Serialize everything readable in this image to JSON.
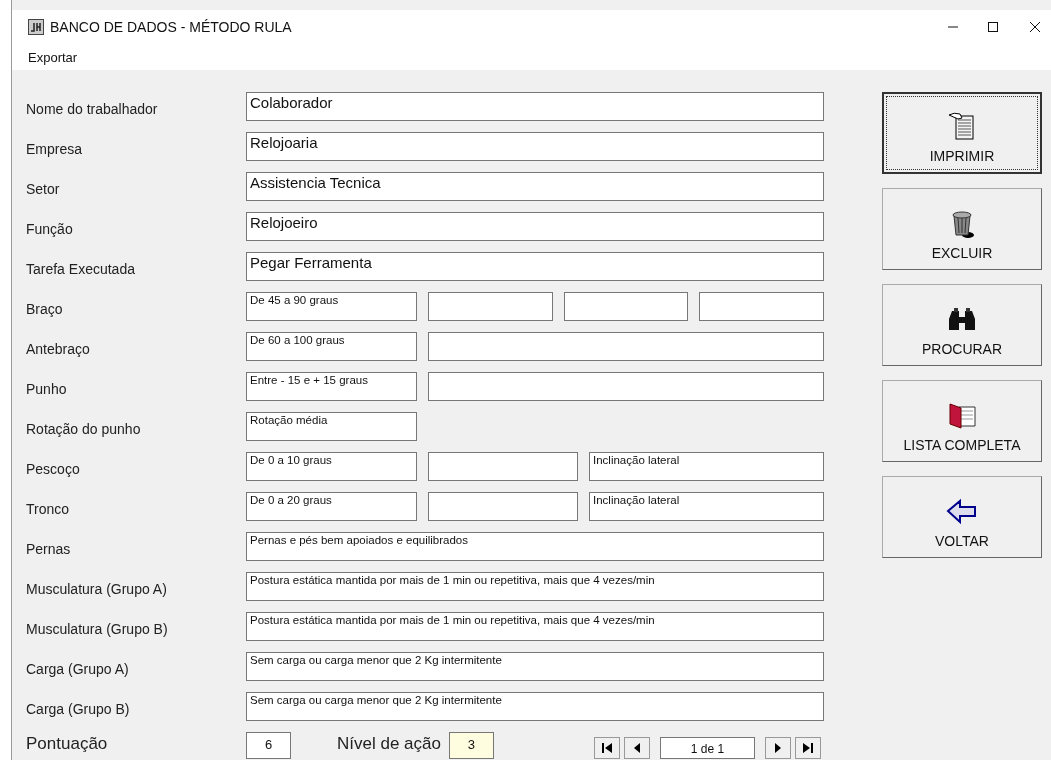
{
  "window": {
    "title": "BANCO DE DADOS - MÉTODO RULA"
  },
  "menu": [
    {
      "label": "Exportar"
    }
  ],
  "rows": [
    {
      "label": "Nome do trabalhador",
      "kind": "text",
      "fields": [
        {
          "kind": "fill",
          "value": "Colaborador"
        }
      ]
    },
    {
      "label": "Empresa",
      "kind": "text",
      "fields": [
        {
          "kind": "fill",
          "value": "Relojoaria"
        }
      ]
    },
    {
      "label": "Setor",
      "kind": "text",
      "fields": [
        {
          "kind": "fill",
          "value": "Assistencia Tecnica"
        }
      ]
    },
    {
      "label": "Função",
      "kind": "text",
      "fields": [
        {
          "kind": "fill",
          "value": "Relojoeiro"
        }
      ]
    },
    {
      "label": "Tarefa Executada",
      "kind": "text",
      "fields": [
        {
          "kind": "fill",
          "value": "Pegar Ferramenta"
        }
      ]
    },
    {
      "label": "Braço",
      "kind": "option",
      "fields": [
        {
          "kind": "short",
          "value": "De 45 a 90 graus"
        },
        {
          "kind": "fill"
        },
        {
          "kind": "fill"
        },
        {
          "kind": "fill"
        }
      ]
    },
    {
      "label": "Antebraço",
      "kind": "option",
      "fields": [
        {
          "kind": "short",
          "value": "De 60 a 100 graus"
        },
        {
          "kind": "fill"
        }
      ]
    },
    {
      "label": "Punho",
      "kind": "option",
      "fields": [
        {
          "kind": "short",
          "value": "Entre - 15 e + 15 graus"
        },
        {
          "kind": "fill"
        }
      ]
    },
    {
      "label": "Rotação do punho",
      "kind": "option",
      "fields": [
        {
          "kind": "short",
          "value": "Rotação média"
        }
      ]
    },
    {
      "label": "Pescoço",
      "kind": "option",
      "fields": [
        {
          "kind": "short",
          "value": "De 0 a 10 graus"
        },
        {
          "kind": "narrow"
        },
        {
          "kind": "fill",
          "value": "Inclinação lateral"
        }
      ]
    },
    {
      "label": "Tronco",
      "kind": "option",
      "fields": [
        {
          "kind": "short",
          "value": "De 0 a 20 graus"
        },
        {
          "kind": "narrow"
        },
        {
          "kind": "fill",
          "value": "Inclinação lateral"
        }
      ]
    },
    {
      "label": "Pernas",
      "kind": "option",
      "fields": [
        {
          "kind": "fill",
          "value": "Pernas e pés bem apoiados e equilibrados"
        }
      ]
    },
    {
      "label": "Musculatura (Grupo A)",
      "kind": "option",
      "fields": [
        {
          "kind": "fill",
          "value": "Postura estática mantida por mais de 1 min ou repetitiva, mais que 4 vezes/min"
        }
      ]
    },
    {
      "label": "Musculatura (Grupo B)",
      "kind": "option",
      "fields": [
        {
          "kind": "fill",
          "value": "Postura estática mantida por mais de 1 min ou repetitiva, mais que 4 vezes/min"
        }
      ]
    },
    {
      "label": "Carga (Grupo A)",
      "kind": "option",
      "fields": [
        {
          "kind": "fill",
          "value": "Sem carga ou carga menor que 2 Kg intermitente"
        }
      ]
    },
    {
      "label": "Carga (Grupo B)",
      "kind": "option",
      "fields": [
        {
          "kind": "fill",
          "value": "Sem carga ou carga menor que 2 Kg intermitente"
        }
      ]
    }
  ],
  "buttons": [
    {
      "label": "IMPRIMIR",
      "kind": "print",
      "focused": true
    },
    {
      "label": "EXCLUIR",
      "kind": "delete",
      "focused": false
    },
    {
      "label": "PROCURAR",
      "kind": "search",
      "focused": false
    },
    {
      "label": "LISTA COMPLETA",
      "kind": "list",
      "focused": false
    },
    {
      "label": "VOLTAR",
      "kind": "back",
      "focused": false
    }
  ],
  "footer": {
    "score_label": "Pontuação",
    "score": "6",
    "action_label": "Nível de ação",
    "action_level": "3",
    "record": "1 de 1"
  }
}
